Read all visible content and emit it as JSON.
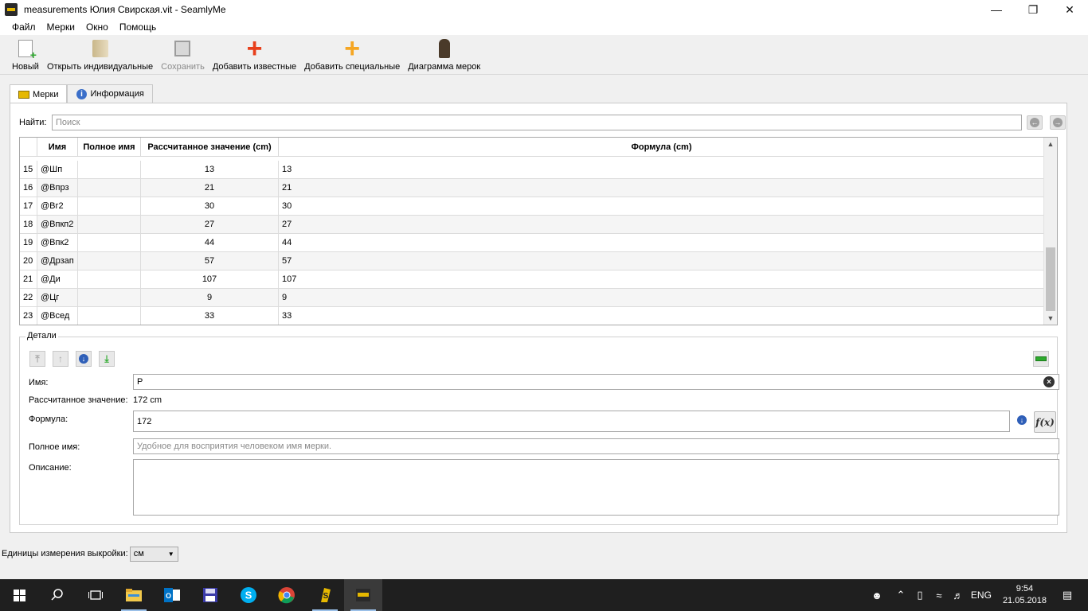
{
  "window": {
    "title": "measurements Юлия Свирская.vit - SeamlyMe"
  },
  "menu": [
    "Файл",
    "Мерки",
    "Окно",
    "Помощь"
  ],
  "toolbar": {
    "new": "Новый",
    "open": "Открыть индивидуальные",
    "save": "Сохранить",
    "add_known": "Добавить известные",
    "add_custom": "Добавить специальные",
    "diagram": "Диаграмма мерок"
  },
  "tabs": {
    "measurements": "Мерки",
    "information": "Информация"
  },
  "search": {
    "label": "Найти:",
    "placeholder": "Поиск"
  },
  "table": {
    "headers": {
      "name": "Имя",
      "full_name": "Полное имя",
      "calculated": "Рассчитанное значение (cm)",
      "formula": "Формула (cm)"
    },
    "rows": [
      {
        "num": "15",
        "name": "@Шп",
        "full_name": "",
        "value": "13",
        "formula": "13"
      },
      {
        "num": "16",
        "name": "@Впрз",
        "full_name": "",
        "value": "21",
        "formula": "21"
      },
      {
        "num": "17",
        "name": "@Вг2",
        "full_name": "",
        "value": "30",
        "formula": "30"
      },
      {
        "num": "18",
        "name": "@Впкп2",
        "full_name": "",
        "value": "27",
        "formula": "27"
      },
      {
        "num": "19",
        "name": "@Впк2",
        "full_name": "",
        "value": "44",
        "formula": "44"
      },
      {
        "num": "20",
        "name": "@Дрзап",
        "full_name": "",
        "value": "57",
        "formula": "57"
      },
      {
        "num": "21",
        "name": "@Ди",
        "full_name": "",
        "value": "107",
        "formula": "107"
      },
      {
        "num": "22",
        "name": "@Цг",
        "full_name": "",
        "value": "9",
        "formula": "9"
      },
      {
        "num": "23",
        "name": "@Всед",
        "full_name": "",
        "value": "33",
        "formula": "33"
      }
    ]
  },
  "details": {
    "title": "Детали",
    "name_label": "Имя:",
    "name_value": "Р",
    "calc_label": "Рассчитанное значение:",
    "calc_value": "172 cm",
    "formula_label": "Формула:",
    "formula_value": "172",
    "full_name_label": "Полное имя:",
    "full_name_placeholder": "Удобное для восприятия человеком имя мерки.",
    "description_label": "Описание:",
    "description_value": "",
    "formula_button": "f(x)"
  },
  "statusbar": {
    "units_label": "Единицы измерения выкройки:",
    "units_value": "см"
  },
  "taskbar": {
    "lang": "ENG",
    "time": "9:54",
    "date": "21.05.2018"
  },
  "colors": {
    "add_known": "#e8401c",
    "add_custom": "#f5a623",
    "taskbar": "#1f1f1f"
  }
}
